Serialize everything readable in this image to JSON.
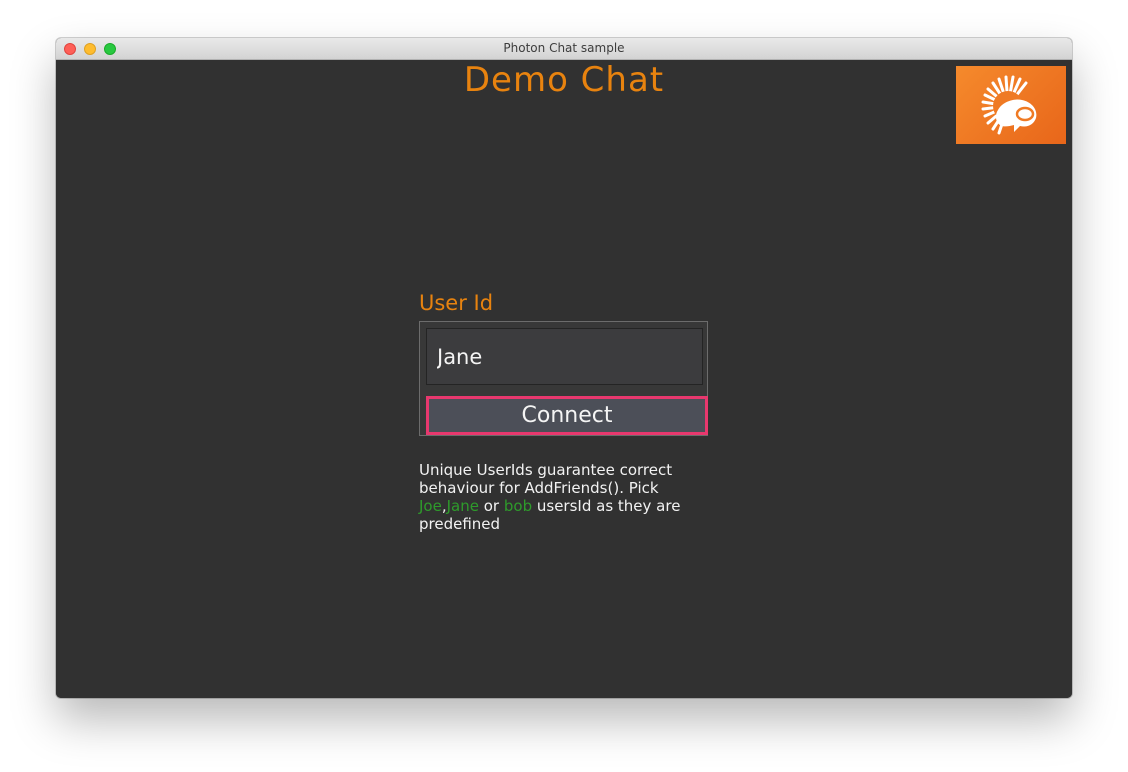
{
  "window": {
    "title": "Photon Chat sample"
  },
  "app": {
    "title": "Demo Chat",
    "logo_icon": "photon-logo-icon",
    "accent_color": "#e8830f",
    "highlight_color": "#e8386e",
    "name_color": "#2e9b2b"
  },
  "form": {
    "label": "User Id",
    "input_value": "Jane",
    "button_label": "Connect"
  },
  "help": {
    "part1": "Unique UserIds guarantee correct behaviour for AddFriends(). Pick ",
    "name1": "Joe",
    "sep": ",",
    "name2": "Jane",
    "part2": " or ",
    "name3": "bob",
    "part3": " usersId as they are predefined"
  }
}
